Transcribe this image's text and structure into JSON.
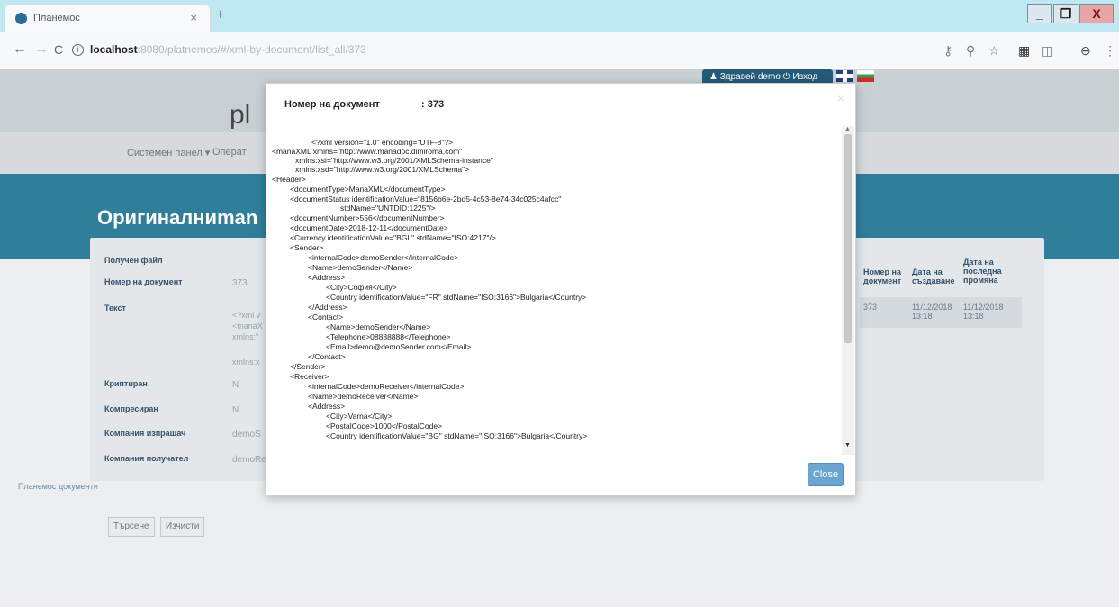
{
  "browser": {
    "tab_title": "Планемос",
    "tab_close": "×",
    "new_tab": "+",
    "url_host": "localhost",
    "url_path": ":8080/platnemos/#/xml-by-document/list_all/373",
    "back": "←",
    "forward": "→",
    "reload": "C",
    "toolbar_icons": [
      "key-icon",
      "zoom-icon",
      "star-icon",
      "extension-icon",
      "screenshot-icon",
      "profile-icon",
      "menu-icon"
    ],
    "window_controls": {
      "minimize": "_",
      "restore": "❐",
      "close": "X"
    }
  },
  "app": {
    "user_label": "Здравей demo",
    "logout_label": "Изход",
    "logo_text": "pl",
    "menu": [
      "Системен панел ▾",
      "Операт"
    ],
    "hero_title": "Оригиналниman",
    "form": {
      "received_file": "Получен файл",
      "doc_number_label": "Номер на документ",
      "doc_number_value": "373",
      "text_label": "Текст",
      "text_lines": [
        "<?xml v",
        "<manaX",
        "xmlns:\"",
        "xmlns:x"
      ],
      "encrypted_label": "Криптиран",
      "encrypted_value": "N",
      "compressed_label": "Компресиран",
      "compressed_value": "N",
      "sender_company_label": "Компания изпращач",
      "sender_company_value": "demoS",
      "receiver_company_label": "Компания получател",
      "receiver_company_value": "demoRe",
      "link": "Планемос документи",
      "search_btn": "Търсене",
      "clear_btn": "Изчисти"
    },
    "table": {
      "headers": [
        [
          "Номер на",
          "документ"
        ],
        [
          "Дата на",
          "създаване"
        ],
        [
          "Дата на",
          "последна",
          "промяна"
        ]
      ],
      "row": {
        "doc_number": "373",
        "created": [
          "11/12/2018",
          "13:18"
        ],
        "modified": [
          "11/12/2018",
          "13:18"
        ]
      }
    }
  },
  "modal": {
    "doc_label": "Номер на документ",
    "doc_value": ": 373",
    "close_label": "Close",
    "xml_lines": [
      "<?xml version=\"1.0\" encoding=\"UTF-8\"?>",
      "<manaXML xmlns=\"http://www.manadoc.dimiroma.com\"",
      "xmlns:xsi=\"http://www.w3.org/2001/XMLSchema-instance\"",
      "xmlns:xsd=\"http://www.w3.org/2001/XMLSchema\">",
      "<Header>",
      "<documentType>ManaXML</documentType>",
      "<documentStatus identificationValue=\"8156b6e-2bd5-4c53-8e74-34c025c4afcc\"",
      "stdName=\"UNTDID:1225\"/>",
      "<documentNumber>556</documentNumber>",
      "<documentDate>2018-12-11</documentDate>",
      "<Currency identificationValue=\"BGL\" stdName=\"ISO:4217\"/>",
      "<Sender>",
      "<internalCode>demoSender</internalCode>",
      "<Name>demoSender</Name>",
      "<Address>",
      "<City>София</City>",
      "<Country identificationValue=\"FR\" stdName=\"ISO:3166\">Bulgaria</Country>",
      "</Address>",
      "<Contact>",
      "<Name>demoSender</Name>",
      "<Telephone>08888888</Telephone>",
      "<Email>demo@demoSender.com</Email>",
      "</Contact>",
      "</Sender>",
      "<Receiver>",
      "<internalCode>demoReceiver</internalCode>",
      "<Name>demoReceiver</Name>",
      "<Address>",
      "<City>Varna</City>",
      "<PostalCode>1000</PostalCode>",
      "<Country identificationValue=\"BG\" stdName=\"ISO:3166\">Bulgaria</Country>"
    ]
  }
}
